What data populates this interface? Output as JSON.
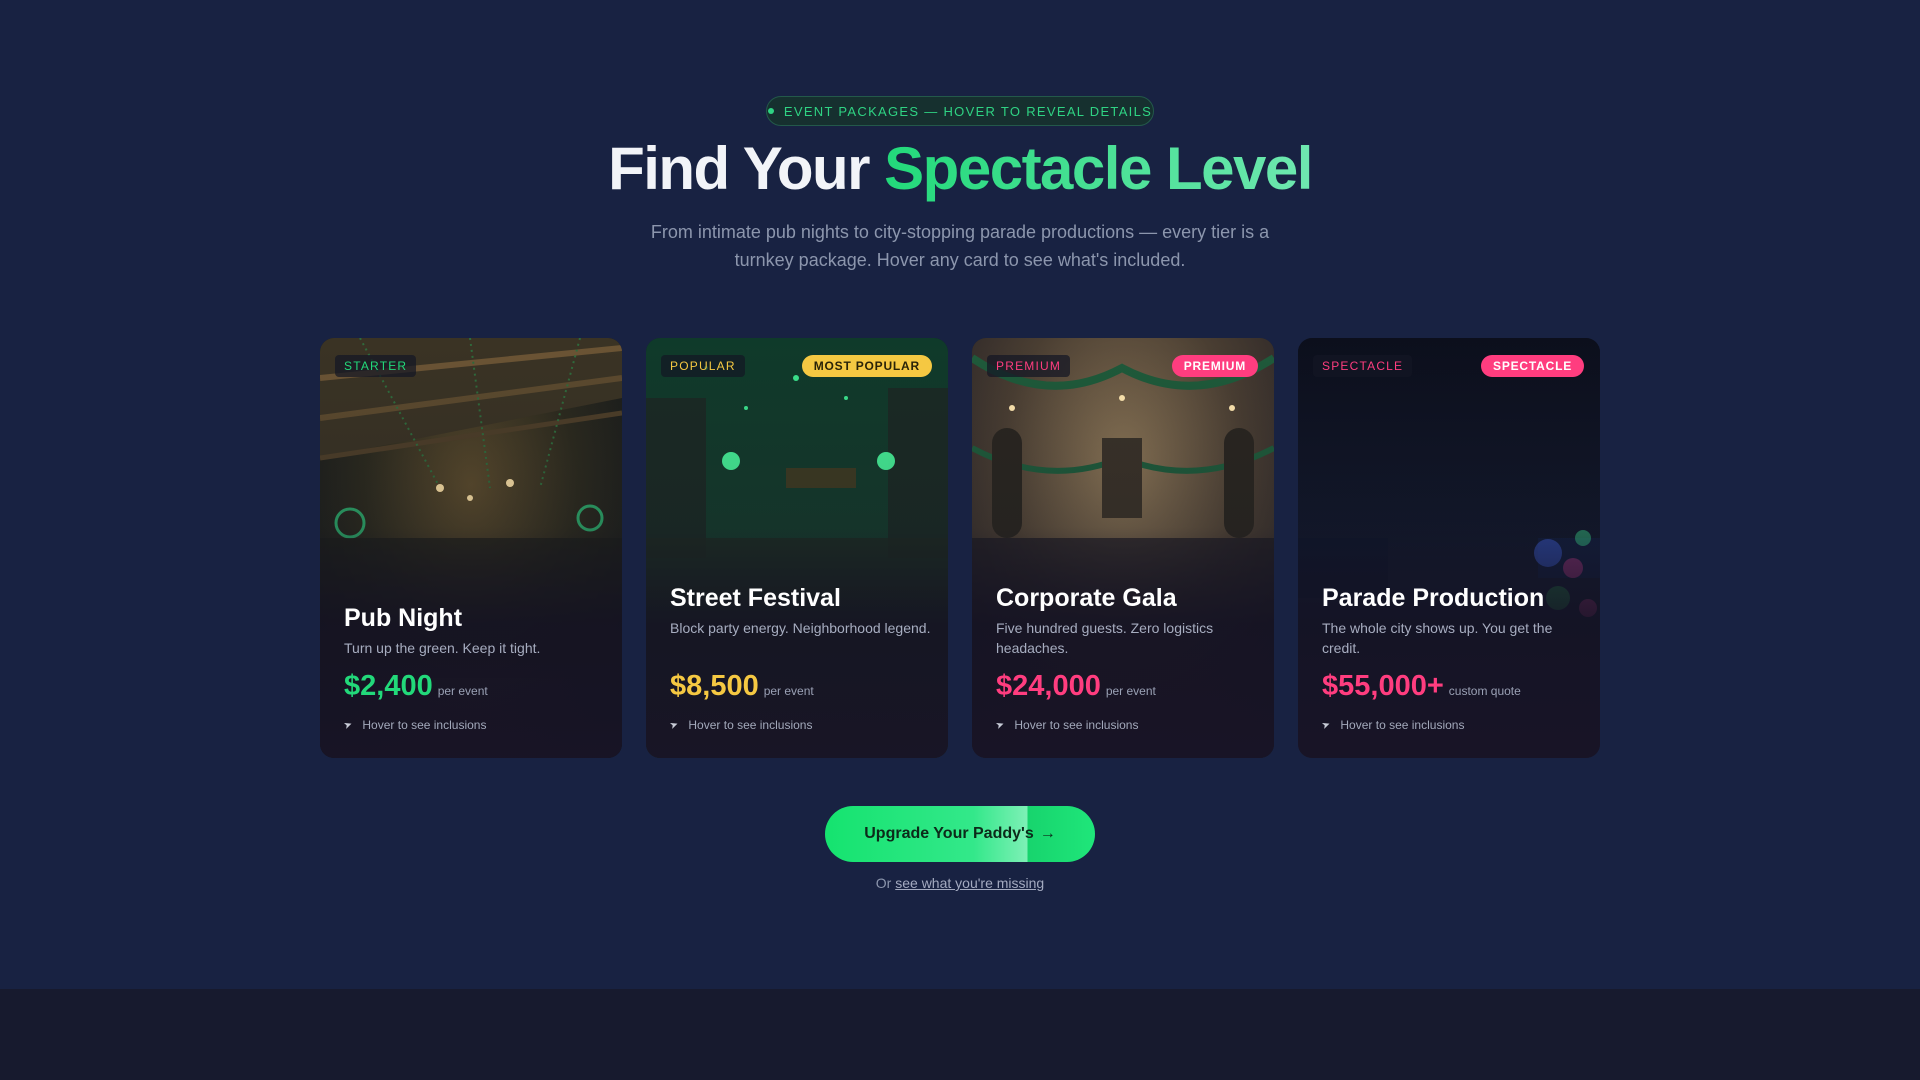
{
  "header": {
    "eyebrow": "EVENT PACKAGES — HOVER TO REVEAL DETAILS",
    "title_plain": "Find Your ",
    "title_accent": "Spectacle Level",
    "subtitle": "From intimate pub nights to city-stopping parade productions — every tier is a turnkey package. Hover any card to see what's included."
  },
  "cards": [
    {
      "tier": "STARTER",
      "badge": "",
      "name": "Pub Night",
      "tagline": "Turn up the green. Keep it tight.",
      "price": "$2,400",
      "unit": "per event",
      "hint": "Hover to see inclusions",
      "accent": "#22d97a"
    },
    {
      "tier": "POPULAR",
      "badge": "MOST POPULAR",
      "name": "Street Festival",
      "tagline": "Block party energy. Neighborhood legend.",
      "price": "$8,500",
      "unit": "per event",
      "hint": "Hover to see inclusions",
      "accent": "#f5c842"
    },
    {
      "tier": "PREMIUM",
      "badge": "PREMIUM",
      "name": "Corporate Gala",
      "tagline": "Five hundred guests. Zero logistics headaches.",
      "price": "$24,000",
      "unit": "per event",
      "hint": "Hover to see inclusions",
      "accent": "#ff3d7f"
    },
    {
      "tier": "SPECTACLE",
      "badge": "SPECTACLE",
      "name": "Parade Production",
      "tagline": "The whole city shows up. You get the credit.",
      "price": "$55,000+",
      "unit": "custom quote",
      "hint": "Hover to see inclusions",
      "accent": "#ff3d7f"
    }
  ],
  "cta": {
    "label": "Upgrade Your Paddy's",
    "arrow": "→",
    "sub_prefix": "Or ",
    "sub_link": "see what you're missing"
  },
  "colors": {
    "background": "#182242",
    "green": "#22d97a",
    "gold": "#f5c842",
    "pink": "#ff3d7f"
  },
  "icons": {
    "hint": "cursor-pointer-icon",
    "eyebrow": "status-dot"
  }
}
